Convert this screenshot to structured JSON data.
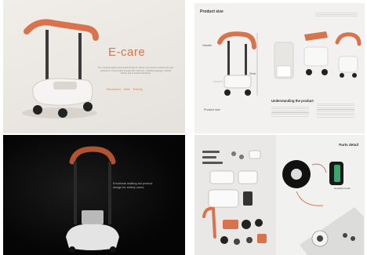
{
  "hero": {
    "title": "E-care",
    "tagline": "Emotional · Safe · Elderly",
    "description": "The emotional walking aid product design for elderly users aims to enhance the user experience of the product through color schemes, modeling language, material choices and emotional interaction."
  },
  "dark": {
    "caption": "Emotional walking aid product design for elderly users."
  },
  "size_sheet": {
    "title": "Product size",
    "labels": {
      "handle": "Handle",
      "seat": "Seat",
      "body": "Product size"
    },
    "understanding": "Understanding the product",
    "footer": "Product size"
  },
  "parts": {
    "title": "Parts detail",
    "callout": "Headlight detail"
  },
  "colors": {
    "accent": "#d9734e",
    "frame": "#3b3b3b",
    "body": "#f4f4f2"
  }
}
